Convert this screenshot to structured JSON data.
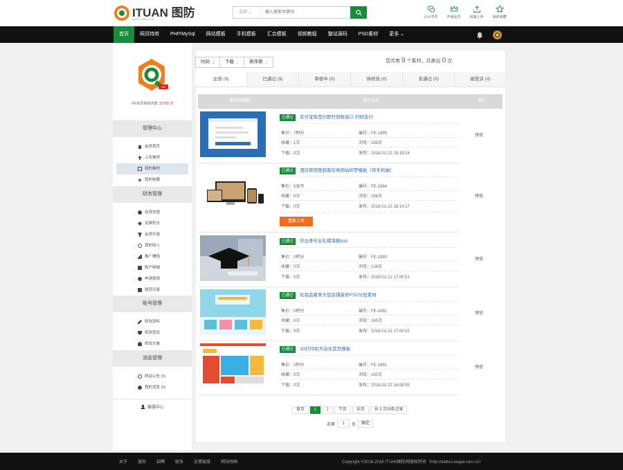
{
  "header": {
    "logo_text": "ITUAN 图防",
    "logo_sub": "www.ITUAN.COM",
    "search_type": "全部",
    "search_placeholder": "输入搜索关键词",
    "links": [
      {
        "label": "公众号号",
        "icon": "wechat-icon"
      },
      {
        "label": "开通会员",
        "icon": "crown-icon"
      },
      {
        "label": "快速上传",
        "icon": "upload-icon"
      },
      {
        "label": "我的收藏",
        "icon": "star-icon"
      }
    ]
  },
  "nav": {
    "items": [
      "首页",
      "网页特效",
      "PHP/MySql",
      "网站模板",
      "手机模板",
      "汇合模板",
      "视频教程",
      "整站源码",
      "PSD素材",
      "更多"
    ]
  },
  "sidebar": {
    "vip_badge": "VIP",
    "vip_label": "VIP会员剩余天数:",
    "vip_days": "32765",
    "vip_unit": "天",
    "sections": [
      {
        "title": "管理中心",
        "items": [
          {
            "label": "会员首页",
            "icon": "home-icon"
          },
          {
            "label": "上传素材",
            "icon": "upload-icon"
          },
          {
            "label": "我的素材",
            "icon": "image-icon",
            "active": true
          },
          {
            "label": "我的收藏",
            "icon": "star-icon"
          }
        ]
      },
      {
        "title": "财务管理",
        "items": [
          {
            "label": "在线充值",
            "icon": "coin-icon"
          },
          {
            "label": "兑换积分",
            "icon": "exchange-icon"
          },
          {
            "label": "会员升级",
            "icon": "trophy-icon"
          },
          {
            "label": "我的收入",
            "icon": "income-icon"
          },
          {
            "label": "推广赚钱",
            "icon": "chart-icon"
          },
          {
            "label": "账户明细",
            "icon": "list-icon"
          },
          {
            "label": "申请提现",
            "icon": "withdraw-icon"
          },
          {
            "label": "提现记录",
            "icon": "record-icon"
          }
        ]
      },
      {
        "title": "账号管理",
        "items": [
          {
            "label": "修改资料",
            "icon": "edit-icon"
          },
          {
            "label": "修改密码",
            "icon": "lock-icon"
          },
          {
            "label": "修改头像",
            "icon": "user-icon"
          }
        ]
      },
      {
        "title": "消息管理",
        "items": [
          {
            "label": "网站公告 (0)",
            "icon": "bulb-icon"
          },
          {
            "label": "我的消息 (0)",
            "icon": "message-icon"
          }
        ]
      }
    ],
    "service": "客服中心"
  },
  "toolbar": {
    "sorts": [
      {
        "label": "时间",
        "arrow": "↓",
        "color": "#3a7bd5"
      },
      {
        "label": "下载",
        "arrow": "↓",
        "color": "#aaaaaa"
      },
      {
        "label": "排序按",
        "arrow": "↓",
        "color": "#aaaaaa"
      }
    ],
    "stat_prefix": "您共有",
    "stat_count": "9",
    "stat_mid": "个素材，共卖出",
    "stat_sold": "0",
    "stat_suffix": "次"
  },
  "tabs": [
    "全部 (9)",
    "已通过 (9)",
    "审核中 (0)",
    "待修改 (0)",
    "未通过 (0)",
    "被投诉 (0)"
  ],
  "table": {
    "headers": [
      "素材缩略图",
      "素材信息",
      "操作"
    ],
    "rows": [
      {
        "status": "已通过",
        "title": "支付宝免签约即时到账接口 扫码支付",
        "price": "售价：7积分",
        "fav": "收藏：1次",
        "downloads": "下载：0次",
        "code": "编号：FE-1995",
        "views": "浏览：189次",
        "date": "发布：2018-01-22 18:19:24",
        "op": "预览",
        "reupload": ""
      },
      {
        "status": "已通过",
        "title": "酒店旅馆度假客房类网站织梦模板（带手机端）",
        "price": "售价：5金币",
        "fav": "收藏：0次",
        "downloads": "下载：0次",
        "code": "编号：FE-1994",
        "views": "浏览：186次",
        "date": "发布：2018-01-22 18:14:27",
        "op": "预览",
        "reupload": "重新上传"
      },
      {
        "status": "已通过",
        "title": "毕业季毕业礼帽海报psd",
        "price": "售价：0积分",
        "fav": "收藏：0次",
        "downloads": "下载：0次",
        "code": "编号：FE-1993",
        "views": "浏览：126次",
        "date": "发布：2018-01-22 17:00:51",
        "op": "预览",
        "reupload": ""
      },
      {
        "status": "已通过",
        "title": "化妆品夏季大促店铺装修PSD分层素材",
        "price": "售价：0积分",
        "fav": "收藏：0次",
        "downloads": "下载：0次",
        "code": "编号：FE-1992",
        "views": "浏览：165次",
        "date": "发布：2018-01-22 17:00:02",
        "op": "预览",
        "reupload": ""
      },
      {
        "status": "已通过",
        "title": "3D打印机平台化首页模板",
        "price": "售价：0积分",
        "fav": "收藏：0次",
        "downloads": "下载：0次",
        "code": "编号：FE-1991",
        "views": "浏览：160次",
        "date": "发布：2018-01-22 16:58:55",
        "op": "预览",
        "reupload": ""
      }
    ]
  },
  "pager": {
    "items": [
      "首页",
      "1",
      "2",
      "下页",
      "末页",
      "共 2 页/9条记录"
    ],
    "goto_prefix": "去第",
    "goto_value": "1",
    "goto_suffix": "页",
    "goto_btn": "确定"
  },
  "footer": {
    "links": [
      "关于",
      "服务",
      "招聘",
      "联系",
      "友情链接",
      "网站地图"
    ],
    "copyright": "Copyright ©2018-2018 ITUAN图防网版权所有（http://dahuo.xiugai.com.cn）"
  },
  "colors": {
    "brand": "#1a8a3b",
    "accent": "#ef7f1a",
    "link": "#2f6ea8",
    "button": "#f36b1b"
  }
}
